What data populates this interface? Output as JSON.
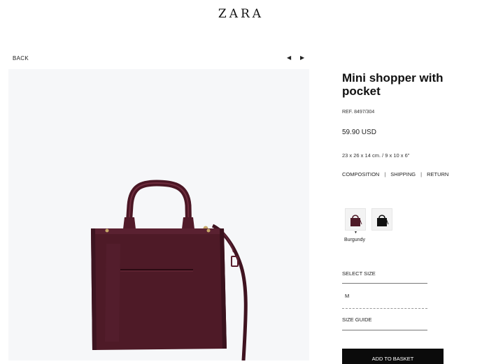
{
  "header": {
    "logo": "ZARA"
  },
  "nav": {
    "back_label": "BACK",
    "prev_icon": "triangle-left-icon",
    "next_icon": "triangle-right-icon"
  },
  "product": {
    "image": "burgundy-mini-shopper-bag-photo",
    "title": "Mini shopper with pocket",
    "ref": "REF. 8497/304",
    "price": "59.90 USD",
    "dimensions": "23 x 26 x 14 cm. / 9 x 10 x 6\"",
    "info_links": [
      "COMPOSITION",
      "SHIPPING",
      "RETURN"
    ],
    "colors": {
      "swatches": [
        {
          "name": "Burgundy",
          "hex": "#4e1a27",
          "selected": true
        },
        {
          "name": "Black",
          "hex": "#111111",
          "selected": false
        }
      ],
      "selected_name": "Burgundy"
    },
    "size": {
      "select_label": "SELECT SIZE",
      "value": "M",
      "guide_label": "SIZE GUIDE"
    },
    "add_to_basket_label": "ADD TO BASKET"
  },
  "colors": {
    "bag": "#4e1a27",
    "photo_bg": "#f6f7f9",
    "button_bg": "#0b0b0b"
  }
}
